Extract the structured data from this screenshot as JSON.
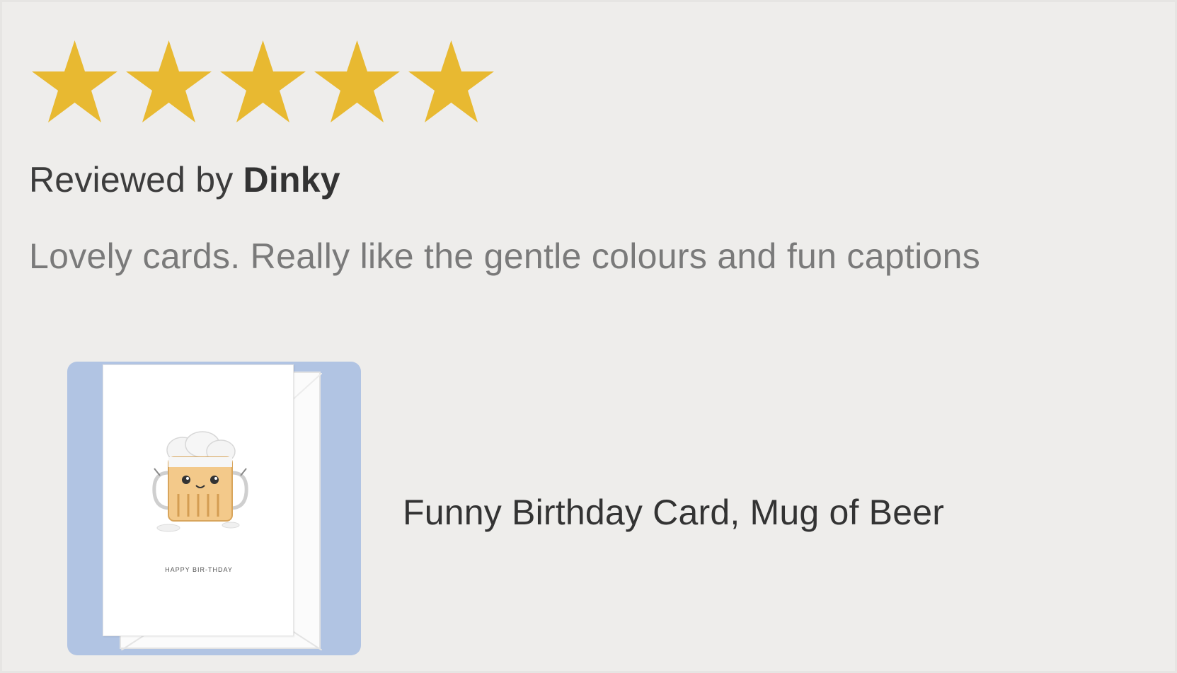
{
  "review": {
    "rating": 5,
    "rating_max": 5,
    "star_color": "#e8b931",
    "reviewed_by_prefix": "Reviewed by ",
    "reviewer_name": "Dinky",
    "text": "Lovely cards. Really like the gentle colours and fun captions"
  },
  "product": {
    "title": "Funny Birthday Card, Mug of Beer",
    "thumbnail_background": "#b1c4e3",
    "card_caption": "HAPPY BIR-THDAY",
    "illustration_icon": "beer-mug-icon"
  }
}
